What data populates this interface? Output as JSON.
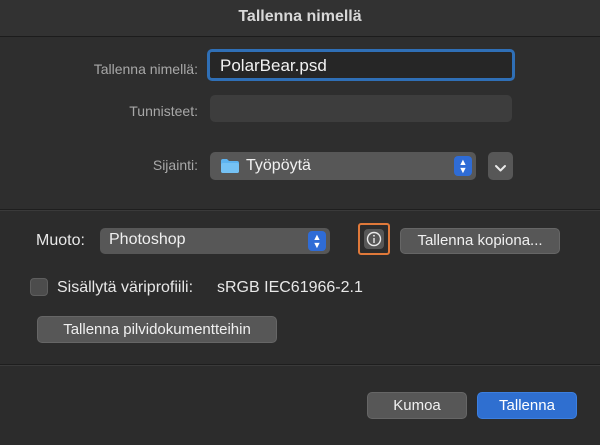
{
  "dialog": {
    "title": "Tallenna nimellä"
  },
  "form": {
    "filename_label": "Tallenna nimellä:",
    "filename_value": "PolarBear.psd",
    "tags_label": "Tunnisteet:",
    "tags_value": "",
    "location_label": "Sijainti:",
    "location_value": "Työpöytä"
  },
  "options": {
    "format_label": "Muoto:",
    "format_value": "Photoshop",
    "save_copy_button": "Tallenna kopiona...",
    "color_profile_label": "Sisällytä väriprofiili:",
    "color_profile_value": "sRGB IEC61966-2.1",
    "color_profile_checked": false,
    "cloud_button": "Tallenna pilvidokumentteihin"
  },
  "actions": {
    "cancel": "Kumoa",
    "save": "Tallenna"
  },
  "colors": {
    "accent": "#2f6fd0",
    "highlight_outline": "#e0793a"
  }
}
